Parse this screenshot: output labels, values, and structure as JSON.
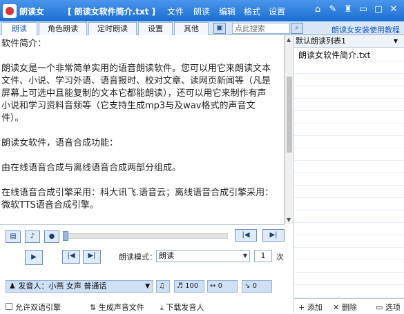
{
  "titlebar": {
    "app_name": "朗读女",
    "file_title": "[ 朗读女软件简介.txt ]",
    "menu": [
      "文件",
      "朗读",
      "编辑",
      "格式",
      "设置"
    ]
  },
  "tabs": [
    "朗读",
    "角色朗读",
    "定时朗读",
    "设置",
    "其他"
  ],
  "search": {
    "placeholder": "点此搜索",
    "icon": "search-icon"
  },
  "help_link": "朗读女安装使用教程",
  "document": {
    "title": "软件简介：",
    "paragraphs": [
      "朗读女是一个非常简单实用的语音朗读软件。您可以用它来朗读文本文件、小说、学习外语、语音报时、校对文章、读网页新闻等（凡是屏幕上可选中且能复制的文本它都能朗读），还可以用它来制作有声小说和学习资料音频等（它支持生成mp3与及wav格式的声音文件）。",
      "",
      "朗读女软件，语音合成功能：",
      "由在线语音合成与离线语音合成两部分组成。",
      "在线语音合成引擎采用：科大讯飞.语音云；离线语音合成引擎采用：微软TTS语音合成引擎。"
    ]
  },
  "playlist": {
    "selected": "默认朗读列表1",
    "items": [
      "朗读女软件简介.txt"
    ],
    "footer": {
      "add": "添加",
      "delete": "删除",
      "options": "选项"
    }
  },
  "controls": {
    "mode_label": "朗读模式：",
    "mode_value": "朗读",
    "repeat_count": "1",
    "repeat_unit": "次",
    "speaker_label": "发音人：小燕 女声 普通话",
    "volume": "100",
    "speed": "0",
    "pitch": "0",
    "bilingual": "允许双语引擎",
    "generate": "生成声音文件",
    "download": "下载发音人"
  }
}
